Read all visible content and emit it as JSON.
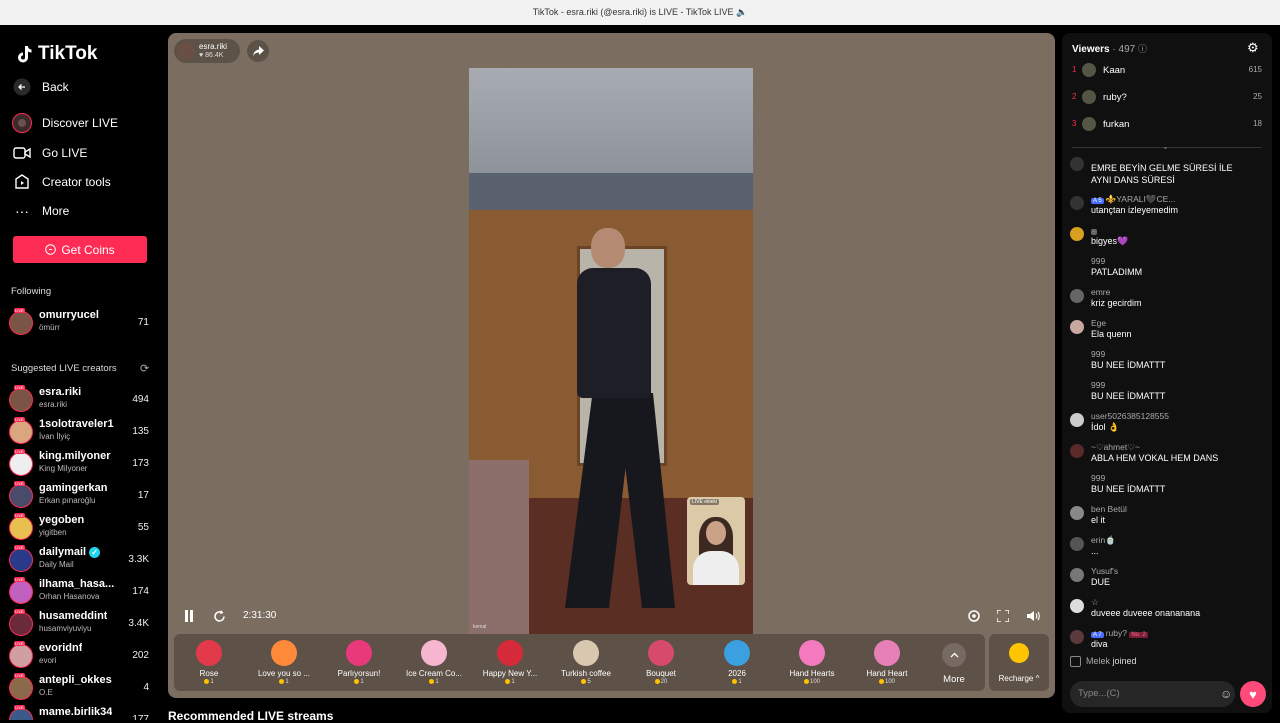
{
  "window": {
    "title": "TikTok - esra.riki (@esra.riki) is LIVE - TikTok LIVE 🔈"
  },
  "sidebar": {
    "logo": "TikTok",
    "nav": [
      {
        "label": "Back",
        "icon": "back-arrow-icon"
      },
      {
        "label": "Discover LIVE",
        "icon": "discover-live-icon"
      },
      {
        "label": "Go LIVE",
        "icon": "video-camera-icon"
      },
      {
        "label": "Creator tools",
        "icon": "creator-tools-icon"
      },
      {
        "label": "More",
        "icon": "more-dots-icon"
      }
    ],
    "get_coins": "Get Coins",
    "following_label": "Following",
    "following": [
      {
        "name": "omurryucel",
        "sub": "ömürr",
        "count": "71"
      }
    ],
    "suggested_label": "Suggested LIVE creators",
    "suggested": [
      {
        "name": "esra.riki",
        "sub": "esra.riki",
        "count": "494"
      },
      {
        "name": "1solotraveler1",
        "sub": "İvan İlyiç",
        "count": "135"
      },
      {
        "name": "king.milyoner",
        "sub": "King Milyoner",
        "count": "173"
      },
      {
        "name": "gamingerkan",
        "sub": "Erkan pınaroğlu",
        "count": "17"
      },
      {
        "name": "yegoben",
        "sub": "yigitben",
        "count": "55"
      },
      {
        "name": "dailymail",
        "sub": "Daily Mail",
        "count": "3.3K",
        "verified": true
      },
      {
        "name": "ilhama_hasa...",
        "sub": "Orhan Hasanova",
        "count": "174"
      },
      {
        "name": "husameddint",
        "sub": "husamviyuviyu",
        "count": "3.4K"
      },
      {
        "name": "evoridnf",
        "sub": "evori",
        "count": "202"
      },
      {
        "name": "antepli_okkes",
        "sub": "O.E",
        "count": "4"
      },
      {
        "name": "mame.birlik34",
        "sub": "",
        "count": "177"
      }
    ]
  },
  "player": {
    "host_name": "esra.riki",
    "host_likes": "♥ 86.4K",
    "time": "2:31:30",
    "pip_label": "LIVE ekleki",
    "video_name": "kemal",
    "gifts": [
      {
        "name": "Rose",
        "price": "1",
        "color": "#e23a4a"
      },
      {
        "name": "Love you so ...",
        "price": "1",
        "color": "#ff8a3a"
      },
      {
        "name": "Parlıyorsun!",
        "price": "1",
        "color": "#e83a7a"
      },
      {
        "name": "Ice Cream Co...",
        "price": "1",
        "color": "#f6b6d0"
      },
      {
        "name": "Happy New Y...",
        "price": "1",
        "color": "#d62a3a"
      },
      {
        "name": "Turkish coffee",
        "price": "5",
        "color": "#d8c8b0"
      },
      {
        "name": "Bouquet",
        "price": "20",
        "color": "#d84a6a"
      },
      {
        "name": "2026",
        "price": "1",
        "color": "#3aa0e0"
      },
      {
        "name": "Hand Hearts",
        "price": "100",
        "color": "#f47ac0"
      },
      {
        "name": "Hand Heart",
        "price": "100",
        "color": "#e880b8"
      }
    ],
    "more_label": "More",
    "recharge_label": "Recharge ^"
  },
  "recommended_title": "Recommended LIVE streams",
  "viewers": {
    "title": "Viewers",
    "count": "· 497",
    "top": [
      {
        "rank": "1",
        "name": "Kaan",
        "score": "615"
      },
      {
        "rank": "2",
        "name": "ruby?",
        "score": "25"
      },
      {
        "rank": "3",
        "name": "furkan",
        "score": "18"
      }
    ]
  },
  "chat": [
    {
      "name": "",
      "msg": "EMRE BEYİN GELME SÜRESİ İLE",
      "msg2": "AYNI DANS SÜRESİ"
    },
    {
      "name": "⚜️YARALI🖤CE...",
      "badge": "A 5",
      "msg": "utançtan izleyemedim"
    },
    {
      "name": "",
      "badge": "",
      "msg": "bigyes💜"
    },
    {
      "name": "999",
      "msg": "PATLADIMM"
    },
    {
      "name": "emre",
      "msg": "kriz gecirdim"
    },
    {
      "name": "Ege",
      "msg": "Ela quenn"
    },
    {
      "name": "999",
      "msg": "BU NEE İDMATTT"
    },
    {
      "name": "999",
      "msg": "BU NEE İDMATTT"
    },
    {
      "name": "user5026385128555",
      "msg": "İdol 👌"
    },
    {
      "name": "~♡ahmet♡~",
      "msg": "ABLA HEM VOKAL HEM DANS"
    },
    {
      "name": "999",
      "msg": "BU NEE İDMATTT"
    },
    {
      "name": "ben Betül",
      "msg": "el it"
    },
    {
      "name": "erin🍵",
      "msg": "..."
    },
    {
      "name": "Yusuf's",
      "msg": "DUE"
    },
    {
      "name": "☆",
      "msg": "duveee duveee onananana"
    },
    {
      "name": "ruby?",
      "badge": "A 7",
      "badge2": "No. 2",
      "msg": "diva"
    }
  ],
  "joined": {
    "name": "Melek",
    "text": "joined"
  },
  "input": {
    "placeholder": "Type...(C)"
  }
}
